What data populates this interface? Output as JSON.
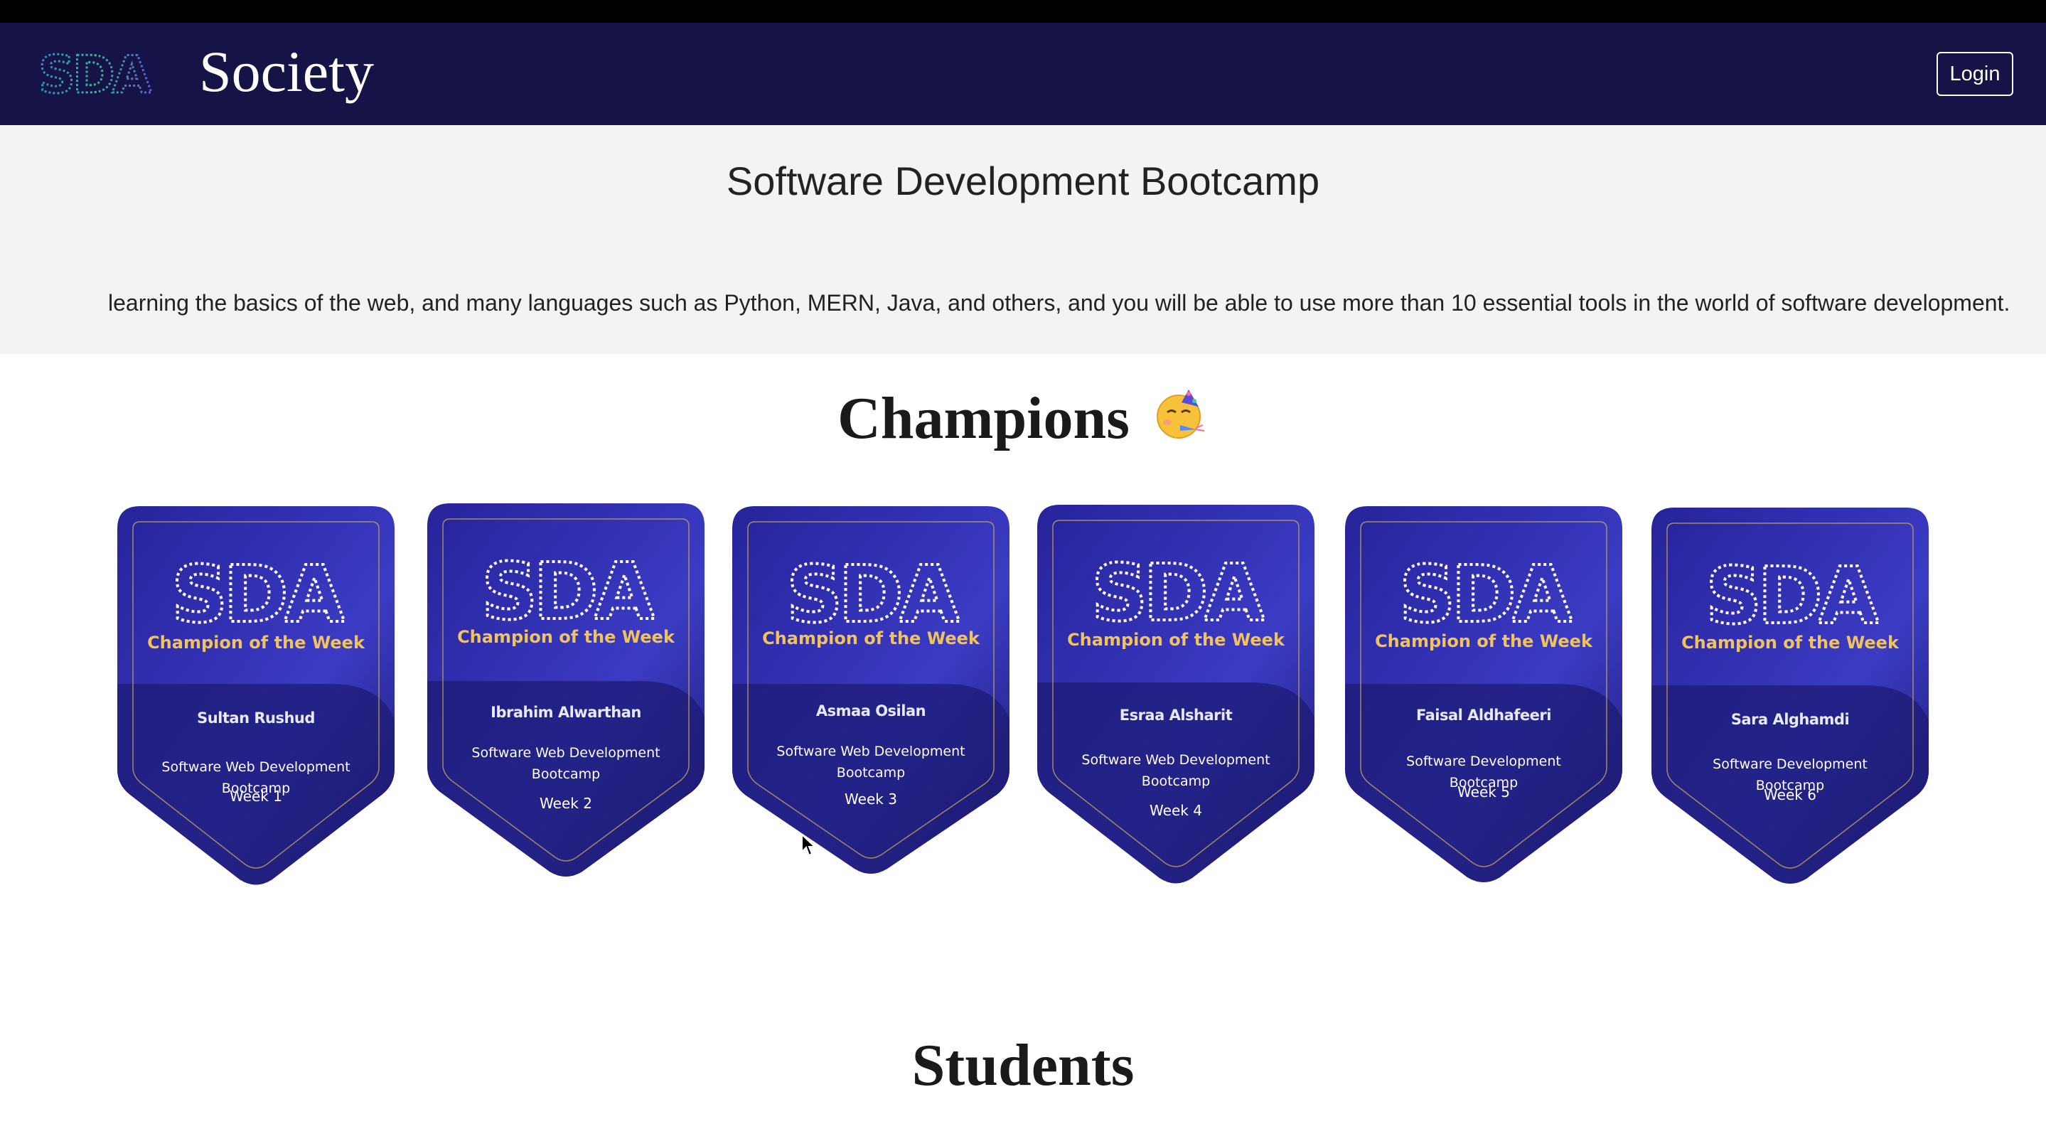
{
  "navbar": {
    "logo_text": "SDA",
    "brand": "Society",
    "login_label": "Login"
  },
  "hero": {
    "title": "Software Development Bootcamp",
    "description": "learning the basics of the web, and many languages such as Python, MERN, Java, and others, and you will be able to use more than 10 essential tools in the world of software development."
  },
  "champions": {
    "title": "Champions",
    "title_icon": "partying-face-icon",
    "badges": [
      {
        "logo": "SDA",
        "subtitle": "Champion of the Week",
        "name": "Sultan Rushud",
        "course": "Software Web Development Bootcamp",
        "week": "Week 1"
      },
      {
        "logo": "SDA",
        "subtitle": "Champion of the Week",
        "name": "Ibrahim Alwarthan",
        "course": "Software Web Development Bootcamp",
        "week": "Week 2"
      },
      {
        "logo": "SDA",
        "subtitle": "Champion of the Week",
        "name": "Asmaa Osilan",
        "course": "Software Web Development Bootcamp",
        "week": "Week 3"
      },
      {
        "logo": "SDA",
        "subtitle": "Champion of the Week",
        "name": "Esraa Alsharit",
        "course": "Software Web Development Bootcamp",
        "week": "Week 4"
      },
      {
        "logo": "SDA",
        "subtitle": "Champion of the Week",
        "name": "Faisal Aldhafeeri",
        "course": "Software Development Bootcamp",
        "week": "Week 5"
      },
      {
        "logo": "SDA",
        "subtitle": "Champion of the Week",
        "name": "Sara Alghamdi",
        "course": "Software Development Bootcamp",
        "week": "Week 6"
      }
    ]
  },
  "students": {
    "title": "Students"
  },
  "colors": {
    "navbar": "#161446",
    "badge_dark": "#1c1a6e",
    "badge_light": "#3b3bc4",
    "gold": "#f2c35a",
    "hero_bg": "#f3f3f3"
  }
}
